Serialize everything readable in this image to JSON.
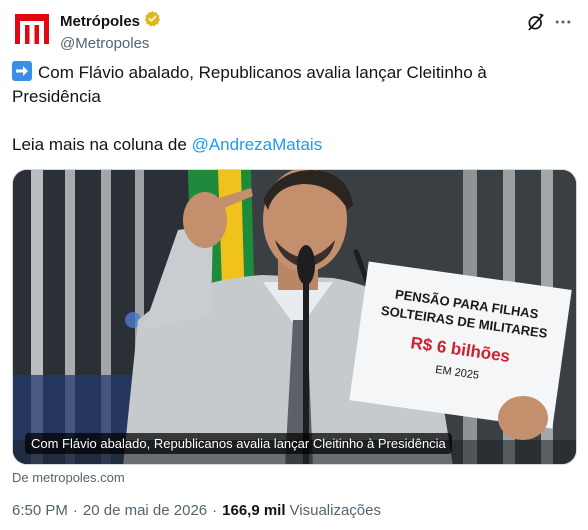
{
  "author": {
    "display_name": "Metrópoles",
    "handle": "@Metropoles",
    "verified": true,
    "brand_color": "#e30613",
    "verified_color": "#e2b719"
  },
  "tweet": {
    "line1": "Com Flávio abalado, Republicanos avalia lançar Cleitinho à Presidência",
    "line2_prefix": "Leia mais na coluna de ",
    "mention": "@AndrezaMatais",
    "arrow_emoji": "➡️"
  },
  "media": {
    "caption": "Com Flávio abalado, Republicanos avalia lançar Cleitinho à Presidência",
    "sign": {
      "line1": "PENSÃO PARA FILHAS",
      "line2": "SOLTEIRAS DE MILITARES",
      "line3": "R$ 6 bilhões",
      "line4": "EM 2025"
    }
  },
  "card_source": "De metropoles.com",
  "meta": {
    "time": "6:50 PM",
    "date": "20 de mai de 2026",
    "views_count": "166,9 mil",
    "views_label": "Visualizações"
  },
  "colors": {
    "text": "#0f1419",
    "secondary": "#536471",
    "link": "#1d9bf0"
  },
  "icons": {
    "grok": "grok-icon",
    "more": "more-icon",
    "verified": "verified-badge-icon",
    "avatar_logo": "metropoles-logo"
  }
}
